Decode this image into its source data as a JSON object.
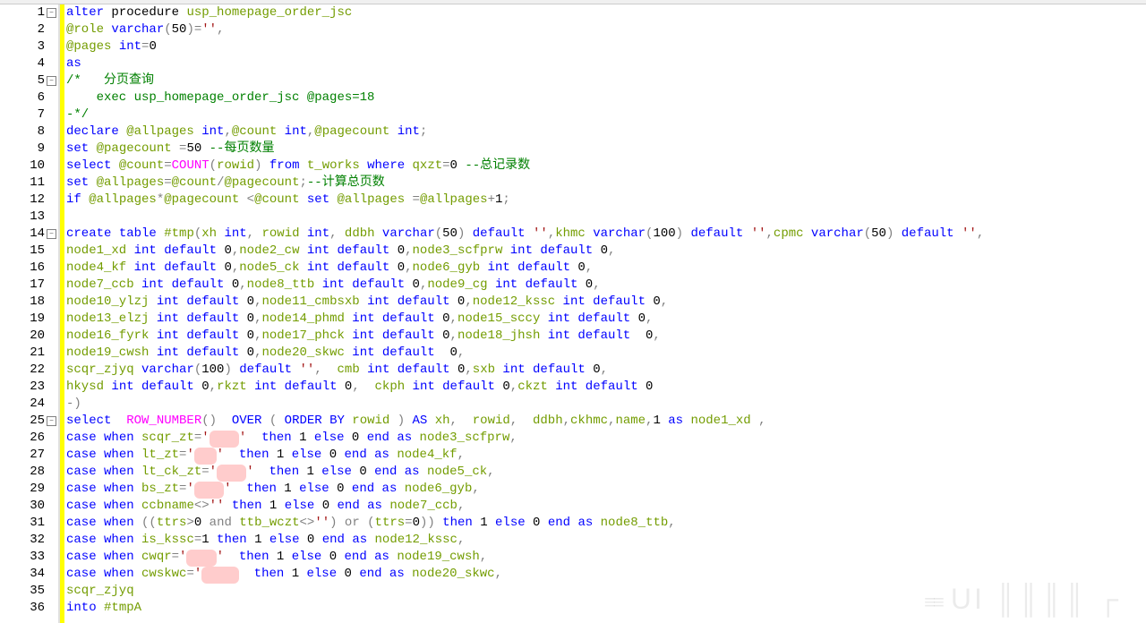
{
  "gutter": {
    "lines": [
      "1",
      "2",
      "3",
      "4",
      "5",
      "6",
      "7",
      "8",
      "9",
      "10",
      "11",
      "12",
      "13",
      "14",
      "15",
      "16",
      "17",
      "18",
      "19",
      "20",
      "21",
      "22",
      "23",
      "24",
      "25",
      "26",
      "27",
      "28",
      "29",
      "30",
      "31",
      "32",
      "33",
      "34",
      "35",
      "36"
    ],
    "fold_at": [
      1,
      5,
      14,
      25
    ]
  },
  "code": {
    "l1": {
      "a": "alter",
      "b": " procedure ",
      "c": "usp_homepage_order_jsc"
    },
    "l2": {
      "a": "@role",
      "b": " varchar",
      "c": "(",
      "d": "50",
      "e": ")=",
      "f": "''",
      "g": ","
    },
    "l3": {
      "a": "@pages",
      "b": " int",
      "c": "=",
      "d": "0"
    },
    "l4": {
      "a": "as"
    },
    "l5": {
      "a": "/*   分页查询"
    },
    "l6": {
      "a": "    exec usp_homepage_order_jsc @pages=18"
    },
    "l7": {
      "a": "-*/"
    },
    "l8": {
      "a": "declare ",
      "b": "@allpages",
      "c": " int",
      "d": ",",
      "e": "@count",
      "f": " int",
      "g": ",",
      "h": "@pagecount",
      "i": " int",
      "j": ";"
    },
    "l9": {
      "a": "set ",
      "b": "@pagecount",
      "c": " =",
      "d": "50",
      "e": " --每页数量"
    },
    "l10": {
      "a": "select ",
      "b": "@count",
      "c": "=",
      "d": "COUNT",
      "e": "(",
      "f": "rowid",
      "g": ")",
      "h": " from ",
      "i": "t_works",
      "j": " where ",
      "k": "qxzt",
      "l": "=",
      "m": "0",
      "n": " --总记录数"
    },
    "l11": {
      "a": "set ",
      "b": "@allpages",
      "c": "=",
      "d": "@count",
      "e": "/",
      "f": "@pagecount",
      "g": ";",
      "h": "--计算总页数"
    },
    "l12": {
      "a": "if ",
      "b": "@allpages",
      "c": "*",
      "d": "@pagecount",
      "e": " <",
      "f": "@count",
      "g": " set ",
      "h": "@allpages",
      "i": " =",
      "j": "@allpages",
      "k": "+",
      "l": "1",
      "m": ";"
    },
    "l13": {
      "a": ""
    },
    "l14": {
      "a": "create",
      "b": " table ",
      "c": "#tmp",
      "d": "(",
      "e": "xh",
      "f": " int",
      "g": ", ",
      "h": "rowid",
      "i": " int",
      "j": ", ",
      "k": "ddbh",
      "l": " varchar",
      "m": "(",
      "n": "50",
      "o": ")",
      "p": " default ",
      "q": "''",
      "r": ",",
      "s": "khmc",
      "t": " varchar",
      "u": "(",
      "v": "100",
      "w": ")",
      "x": " default ",
      "y": "''",
      "z": ",",
      "A": "cpmc",
      "B": " varchar",
      "C": "(",
      "D": "50",
      "E": ")",
      "F": " default ",
      "G": "''",
      "H": ","
    },
    "l15": {
      "a": "node1_xd",
      "b": " int",
      "c": " default ",
      "d": "0",
      "e": ",",
      "f": "node2_cw",
      "g": " int",
      "h": " default ",
      "i": "0",
      "j": ",",
      "k": "node3_scfprw",
      "l": " int",
      "m": " default ",
      "n": "0",
      "o": ","
    },
    "l16": {
      "a": "node4_kf",
      "b": " int",
      "c": " default ",
      "d": "0",
      "e": ",",
      "f": "node5_ck",
      "g": " int",
      "h": " default ",
      "i": "0",
      "j": ",",
      "k": "node6_gyb",
      "l": " int",
      "m": " default ",
      "n": "0",
      "o": ","
    },
    "l17": {
      "a": "node7_ccb",
      "b": " int",
      "c": " default ",
      "d": "0",
      "e": ",",
      "f": "node8_ttb",
      "g": " int",
      "h": " default ",
      "i": "0",
      "j": ",",
      "k": "node9_cg",
      "l": " int",
      "m": " default ",
      "n": "0",
      "o": ","
    },
    "l18": {
      "a": "node10_ylzj",
      "b": " int",
      "c": " default ",
      "d": "0",
      "e": ",",
      "f": "node11_cmbsxb",
      "g": " int",
      "h": " default ",
      "i": "0",
      "j": ",",
      "k": "node12_kssc",
      "l": " int",
      "m": " default ",
      "n": "0",
      "o": ","
    },
    "l19": {
      "a": "node13_elzj",
      "b": " int",
      "c": " default ",
      "d": "0",
      "e": ",",
      "f": "node14_phmd",
      "g": " int",
      "h": " default ",
      "i": "0",
      "j": ",",
      "k": "node15_sccy",
      "l": " int",
      "m": " default ",
      "n": "0",
      "o": ","
    },
    "l20": {
      "a": "node16_fyrk",
      "b": " int",
      "c": " default ",
      "d": "0",
      "e": ",",
      "f": "node17_phck",
      "g": " int",
      "h": " default ",
      "i": "0",
      "j": ",",
      "k": "node18_jhsh",
      "l": " int",
      "m": " default  ",
      "n": "0",
      "o": ","
    },
    "l21": {
      "a": "node19_cwsh",
      "b": " int",
      "c": " default ",
      "d": "0",
      "e": ",",
      "f": "node20_skwc",
      "g": " int",
      "h": " default  ",
      "i": "0",
      "j": ","
    },
    "l22": {
      "a": "scqr_zjyq",
      "b": " varchar",
      "c": "(",
      "d": "100",
      "e": ")",
      "f": " default ",
      "g": "''",
      "h": ",  ",
      "i": "cmb",
      "j": " int",
      "k": " default ",
      "l": "0",
      "m": ",",
      "n": "sxb",
      "o": " int",
      "p": " default ",
      "q": "0",
      "r": ","
    },
    "l23": {
      "a": "hkysd",
      "b": " int",
      "c": " default ",
      "d": "0",
      "e": ",",
      "f": "rkzt",
      "g": " int",
      "h": " default ",
      "i": "0",
      "j": ",  ",
      "k": "ckph",
      "l": " int",
      "m": " default ",
      "n": "0",
      "o": ",",
      "p": "ckzt",
      "q": " int",
      "r": " default ",
      "s": "0"
    },
    "l24": {
      "a": "-)"
    },
    "l25": {
      "a": "select  ",
      "b": "ROW_NUMBER",
      "c": "()",
      "d": "  OVER ",
      "e": "(",
      "f": " ORDER",
      "g": " BY ",
      "h": "rowid",
      "i": " )",
      "j": " AS ",
      "k": "xh",
      "l": ",  ",
      "m": "rowid",
      "n": ",  ",
      "o": "ddbh",
      "p": ",",
      "q": "ckhmc",
      "r": ",",
      "s": "name",
      "t": ",",
      "u": "1",
      "v": " as ",
      "w": "node1_xd",
      "x": " ,"
    },
    "l26": {
      "a": "case",
      "b": " when ",
      "c": "scqr_zt",
      "d": "=",
      "e": "'",
      "f": "███",
      "g": "'",
      "h": "  then ",
      "i": "1",
      "j": " else ",
      "k": "0",
      "l": " end",
      "m": " as ",
      "n": "node3_scfprw",
      "o": ","
    },
    "l27": {
      "a": "case",
      "b": " when ",
      "c": "lt_zt",
      "d": "=",
      "e": "'",
      "f": "██",
      "g": "'",
      "h": "  then ",
      "i": "1",
      "j": " else ",
      "k": "0",
      "l": " end",
      "m": " as ",
      "n": "node4_kf",
      "o": ","
    },
    "l28": {
      "a": "case",
      "b": " when ",
      "c": "lt_ck_zt",
      "d": "=",
      "e": "'",
      "f": "███",
      "g": "'",
      "h": "  then ",
      "i": "1",
      "j": " else ",
      "k": "0",
      "l": " end",
      "m": " as ",
      "n": "node5_ck",
      "o": ","
    },
    "l29": {
      "a": "case",
      "b": " when ",
      "c": "bs_zt",
      "d": "=",
      "e": "'",
      "f": "███",
      "g": "'",
      "h": "  then ",
      "i": "1",
      "j": " else ",
      "k": "0",
      "l": " end",
      "m": " as ",
      "n": "node6_gyb",
      "o": ","
    },
    "l30": {
      "a": "case",
      "b": " when ",
      "c": "ccbname",
      "d": "<>",
      "e": "''",
      "f": " then ",
      "g": "1",
      "h": " else ",
      "i": "0",
      "j": " end",
      "k": " as ",
      "l": "node7_ccb",
      "m": ","
    },
    "l31": {
      "a": "case",
      "b": " when ",
      "c": "((",
      "d": "ttrs",
      "e": ">",
      "f": "0",
      "g": " and ",
      "h": "ttb_wczt",
      "i": "<>",
      "j": "''",
      "k": ")",
      "l": " or ",
      "m": "(",
      "n": "ttrs",
      "o": "=",
      "p": "0",
      "q": "))",
      "r": " then ",
      "s": "1",
      "t": " else ",
      "u": "0",
      "v": " end",
      "w": " as ",
      "x": "node8_ttb",
      "y": ","
    },
    "l32": {
      "a": "case",
      "b": " when ",
      "c": "is_kssc",
      "d": "=",
      "e": "1",
      "f": " then ",
      "g": "1",
      "h": " else ",
      "i": "0",
      "j": " end",
      "k": " as ",
      "l": "node12_kssc",
      "m": ","
    },
    "l33": {
      "a": "case",
      "b": " when ",
      "c": "cwqr",
      "d": "=",
      "e": "'",
      "f": "███",
      "g": "'",
      "h": "  then ",
      "i": "1",
      "j": " else ",
      "k": "0",
      "l": " end",
      "m": " as ",
      "n": "node19_cwsh",
      "o": ","
    },
    "l34": {
      "a": "case",
      "b": " when ",
      "c": "cwskwc",
      "d": "=",
      "e": "'",
      "f": "████",
      "g": "  then ",
      "h": "1",
      "i": " else ",
      "j": "0",
      "k": " end",
      "l": " as ",
      "m": "node20_skwc",
      "n": ","
    },
    "l35": {
      "a": "scqr_zjyq"
    },
    "l36": {
      "a": "into ",
      "b": "#tmpA"
    }
  },
  "watermark": "UI ║║║║ ┌"
}
